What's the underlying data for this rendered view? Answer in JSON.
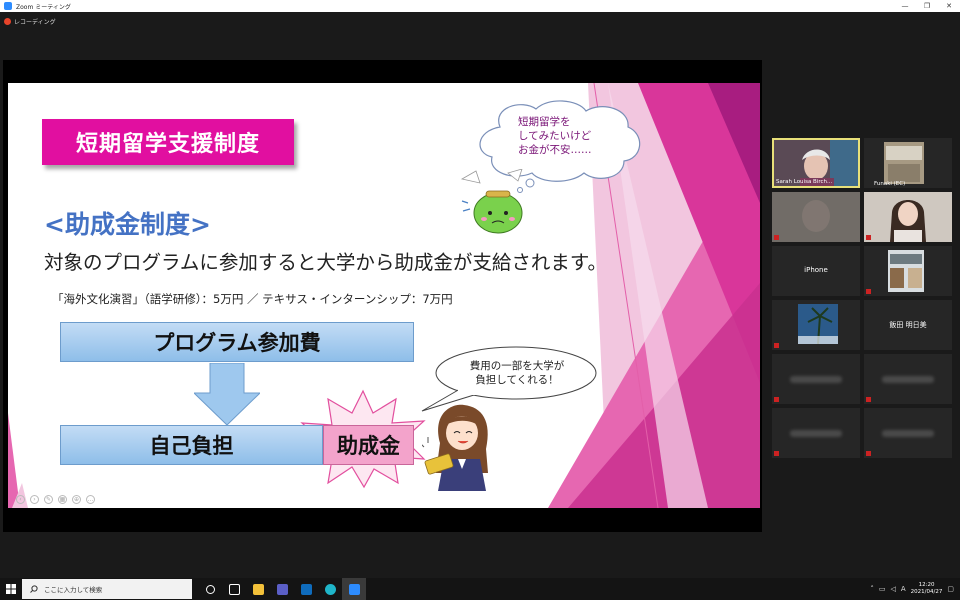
{
  "window": {
    "title": "Zoom ミーティング",
    "controls": [
      "—",
      "❐",
      "✕"
    ]
  },
  "recording": {
    "label": "レコーディング"
  },
  "slide": {
    "title": "短期留学支援制度",
    "subhead": "<助成金制度>",
    "lead": "対象のプログラムに参加すると大学から助成金が支給されます。",
    "detail": "「海外文化演習」（語学研修）：5万円 ／ テキサス・インターンシップ：7万円",
    "program_box": "プログラム参加費",
    "self_box": "自己負担",
    "grant_box": "助成金",
    "bubble1": [
      "短期留学を",
      "してみたいけど",
      "お金が不安……"
    ],
    "bubble2": [
      "費用の一部を大学が",
      "負担してくれる！"
    ]
  },
  "participants": [
    {
      "name": "Sarah Louisa Birch...",
      "active": true,
      "color": "#5a4a55"
    },
    {
      "name": "Funaki (EC)",
      "active": false,
      "color": "#a79a83"
    },
    {
      "name": "",
      "active": false,
      "color": "#6e665e"
    },
    {
      "name": "",
      "active": false,
      "color": "#8a7a70"
    },
    {
      "name": "iPhone",
      "active": false,
      "color": "#262626"
    },
    {
      "name": "",
      "active": false,
      "color": "#6d7a80"
    },
    {
      "name": "",
      "active": false,
      "color": "#2b5a8a"
    },
    {
      "name": "飯田 明日美",
      "active": false,
      "color": "#262626"
    },
    {
      "name": "",
      "active": false,
      "color": "#262626"
    },
    {
      "name": "",
      "active": false,
      "color": "#262626"
    },
    {
      "name": "",
      "active": false,
      "color": "#262626"
    },
    {
      "name": "",
      "active": false,
      "color": "#262626"
    }
  ],
  "taskbar": {
    "search_placeholder": "ここに入力して検索",
    "time": "12:20",
    "date": "2021/04/27",
    "ime": "A"
  }
}
